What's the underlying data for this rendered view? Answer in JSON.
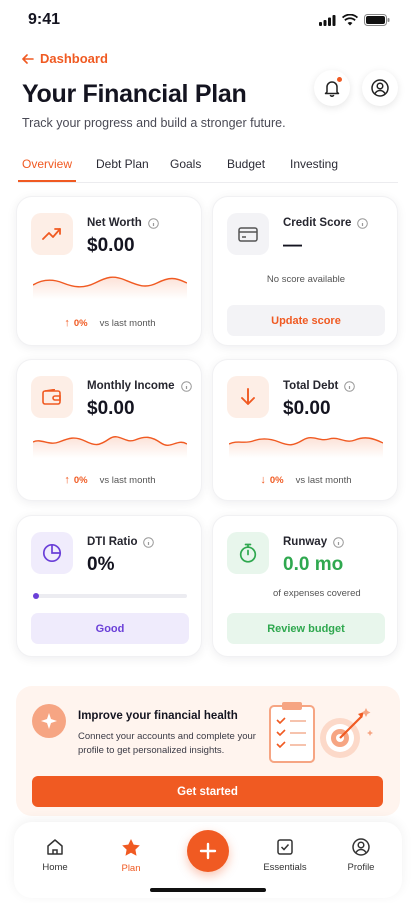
{
  "status_bar": {
    "time": "9:41"
  },
  "header": {
    "back_label": "Dashboard",
    "title": "Your Financial Plan",
    "subtitle": "Track your progress and build a stronger future."
  },
  "tabs": [
    "Overview",
    "Debt Plan",
    "Goals",
    "Budget",
    "Investing"
  ],
  "cards": {
    "net_worth": {
      "label": "Net Worth",
      "value": "$0.00",
      "delta_pct": "0%",
      "delta_text": "vs last month"
    },
    "credit_score": {
      "label": "Credit Score",
      "value": "—",
      "note": "No score available",
      "button": "Update score"
    },
    "monthly_income": {
      "label": "Monthly Income",
      "value": "$0.00",
      "delta_pct": "0%",
      "delta_text": "vs last month"
    },
    "total_debt": {
      "label": "Total Debt",
      "value": "$0.00",
      "delta_pct": "0%",
      "delta_text": "vs last month"
    },
    "dti_ratio": {
      "label": "DTI Ratio",
      "value": "0%",
      "progress": 0,
      "status": "Good"
    },
    "runway": {
      "label": "Runway",
      "value": "0.0 mo",
      "note": "of expenses covered",
      "button": "Review budget"
    }
  },
  "banner": {
    "title": "Improve your financial health",
    "text": "Connect your accounts and complete your profile to get personalized insights.",
    "cta": "Get started"
  },
  "bottom_nav": {
    "items": [
      "Home",
      "Plan",
      "Essentials",
      "Profile"
    ],
    "active": "Plan"
  },
  "colors": {
    "accent": "#f05a22",
    "green": "#2fa84f",
    "purple": "#6a3fd8"
  }
}
